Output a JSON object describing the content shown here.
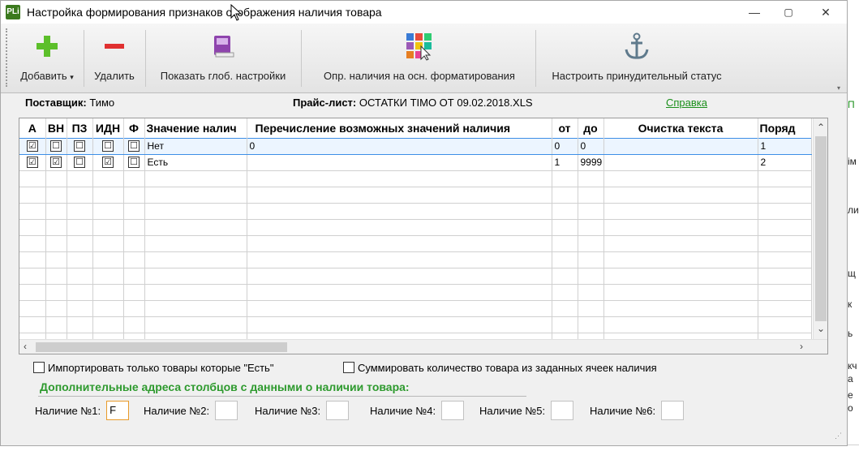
{
  "window": {
    "app_icon_text": "PLi",
    "title": "Настройка формирования признаков отображения наличия товара",
    "minimize": "—",
    "maximize": "▢",
    "close": "✕"
  },
  "toolbar": {
    "add_label": "Добавить",
    "delete_label": "Удалить",
    "global_settings_label": "Показать глоб. настройки",
    "availability_label": "Опр. наличия на осн. форматирования",
    "forced_status_label": "Настроить принудительный статус",
    "dropdown_glyph": "▾"
  },
  "header": {
    "supplier_label": "Поставщик:",
    "supplier_value": "Тимо",
    "pricelist_label": "Прайс-лист:",
    "pricelist_value": "ОСТАТКИ TIMO ОТ 09.02.2018.XLS",
    "help_link": "Справка"
  },
  "grid": {
    "columns": [
      "А",
      "ВН",
      "ПЗ",
      "ИДН",
      "Ф",
      "Значение налич",
      "Перечисление возможных значений наличия",
      "от",
      "до",
      "Очистка текста",
      "Поряд"
    ],
    "rows": [
      {
        "a": "☑",
        "vn": "☐",
        "pz": "☐",
        "idn": "☐",
        "f": "☐",
        "value": "Нет",
        "enum": "0",
        "from": "0",
        "to": "0",
        "clean": "",
        "order": "1"
      },
      {
        "a": "☑",
        "vn": "☑",
        "pz": "☐",
        "idn": "☑",
        "f": "☐",
        "value": "Есть",
        "enum": "",
        "from": "1",
        "to": "9999",
        "clean": "",
        "order": "2"
      }
    ]
  },
  "options": {
    "import_only_label": "Импортировать только товары которые \"Есть\"",
    "sum_label": "Суммировать количество товара из заданных ячеек наличия"
  },
  "addresses": {
    "title": "Дополнительные адреса столбцов с данными о наличии товара:",
    "fields": [
      {
        "label": "Наличие №1:",
        "value": "F"
      },
      {
        "label": "Наличие №2:",
        "value": ""
      },
      {
        "label": "Наличие №3:",
        "value": ""
      },
      {
        "label": "Наличие №4:",
        "value": ""
      },
      {
        "label": "Наличие №5:",
        "value": ""
      },
      {
        "label": "Наличие №6:",
        "value": ""
      }
    ]
  },
  "background": {
    "fragments": [
      "ім",
      "ли",
      "щ",
      "к",
      "ь",
      "кч",
      "а",
      "е",
      "о"
    ]
  },
  "colors": {
    "accent_green": "#2e9a2e",
    "selection_border": "#3d8ee6",
    "active_field_border": "#e89b2a"
  }
}
